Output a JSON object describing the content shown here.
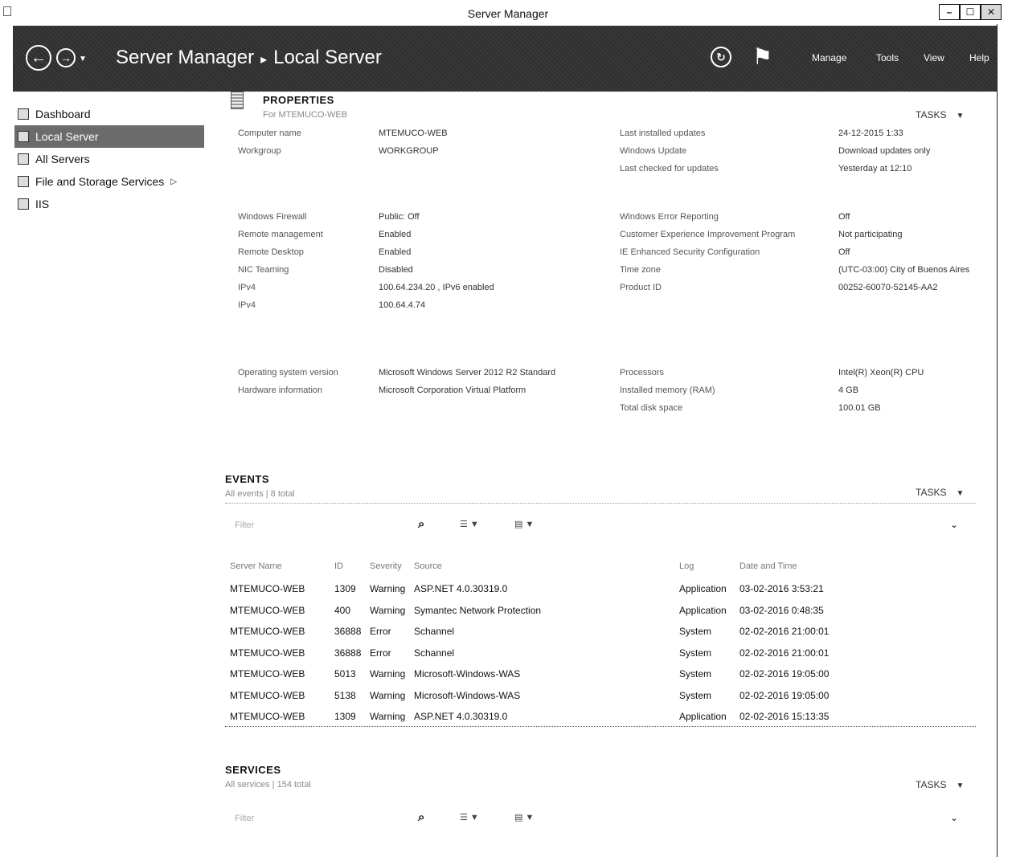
{
  "window": {
    "title": "Server Manager",
    "controls": {
      "minimize": "–",
      "maximize": "☐",
      "close": "✕"
    }
  },
  "header": {
    "breadcrumb_root": "Server Manager",
    "breadcrumb_sep": "▸",
    "breadcrumb_current": "Local Server",
    "menus": [
      "Manage",
      "Tools",
      "View",
      "Help"
    ]
  },
  "sidebar": {
    "items": [
      {
        "label": "Dashboard",
        "icon": "dashboard-icon",
        "active": false
      },
      {
        "label": "Local Server",
        "icon": "server-icon",
        "active": true
      },
      {
        "label": "All Servers",
        "icon": "servers-icon",
        "active": false
      },
      {
        "label": "File and Storage Services",
        "icon": "storage-icon",
        "active": false,
        "arrow": "▷"
      },
      {
        "label": "IIS",
        "icon": "iis-icon",
        "active": false
      }
    ]
  },
  "properties": {
    "title": "PROPERTIES",
    "subtitle": "For MTEMUCO-WEB",
    "tasks": "TASKS",
    "block1": [
      {
        "label": "Computer name",
        "value": "MTEMUCO-WEB",
        "label2": "Last installed updates",
        "value2": "24-12-2015 1:33"
      },
      {
        "label": "Workgroup",
        "value": "WORKGROUP",
        "label2": "Windows Update",
        "value2": "Download updates only"
      },
      {
        "label": "",
        "value": "",
        "label2": "Last checked for updates",
        "value2": "Yesterday at 12:10"
      }
    ],
    "block2": [
      {
        "label": "Windows Firewall",
        "value": "Public: Off",
        "label2": "Windows Error Reporting",
        "value2": "Off"
      },
      {
        "label": "Remote management",
        "value": "Enabled",
        "label2": "Customer Experience Improvement Program",
        "value2": "Not participating"
      },
      {
        "label": "Remote Desktop",
        "value": "Enabled",
        "label2": "IE Enhanced Security Configuration",
        "value2": "Off"
      },
      {
        "label": "NIC Teaming",
        "value": "Disabled",
        "label2": "Time zone",
        "value2": "(UTC-03:00) City of Buenos Aires"
      },
      {
        "label": "IPv4",
        "value": "100.64.234.20 , IPv6 enabled",
        "label2": "Product ID",
        "value2": "00252-60070-52145-AA2"
      },
      {
        "label": "IPv4",
        "value": "100.64.4.74",
        "label2": "",
        "value2": ""
      }
    ],
    "block3": [
      {
        "label": "Operating system version",
        "value": "Microsoft Windows Server 2012 R2 Standard",
        "label2": "Processors",
        "value2": "Intel(R) Xeon(R) CPU"
      },
      {
        "label": "Hardware information",
        "value": "Microsoft Corporation Virtual Platform",
        "label2": "Installed memory (RAM)",
        "value2": "4 GB"
      },
      {
        "label": "",
        "value": "",
        "label2": "Total disk space",
        "value2": "100.01 GB"
      }
    ]
  },
  "events": {
    "title": "EVENTS",
    "subtitle": "All events | 8 total",
    "tasks": "TASKS",
    "filter_placeholder": "Filter",
    "columns": [
      "Server Name",
      "ID",
      "Severity",
      "Source",
      "Log",
      "Date and Time"
    ],
    "rows": [
      [
        "MTEMUCO-WEB",
        "1309",
        "Warning",
        "ASP.NET 4.0.30319.0",
        "Application",
        "03-02-2016 3:53:21"
      ],
      [
        "MTEMUCO-WEB",
        "400",
        "Warning",
        "Symantec Network Protection",
        "Application",
        "03-02-2016 0:48:35"
      ],
      [
        "MTEMUCO-WEB",
        "36888",
        "Error",
        "Schannel",
        "System",
        "02-02-2016 21:00:01"
      ],
      [
        "MTEMUCO-WEB",
        "36888",
        "Error",
        "Schannel",
        "System",
        "02-02-2016 21:00:01"
      ],
      [
        "MTEMUCO-WEB",
        "5013",
        "Warning",
        "Microsoft-Windows-WAS",
        "System",
        "02-02-2016 19:05:00"
      ],
      [
        "MTEMUCO-WEB",
        "5138",
        "Warning",
        "Microsoft-Windows-WAS",
        "System",
        "02-02-2016 19:05:00"
      ],
      [
        "MTEMUCO-WEB",
        "1309",
        "Warning",
        "ASP.NET 4.0.30319.0",
        "Application",
        "02-02-2016 15:13:35"
      ]
    ]
  },
  "services": {
    "title": "SERVICES",
    "subtitle": "All services | 154 total",
    "tasks": "TASKS",
    "filter_placeholder": "Filter"
  }
}
